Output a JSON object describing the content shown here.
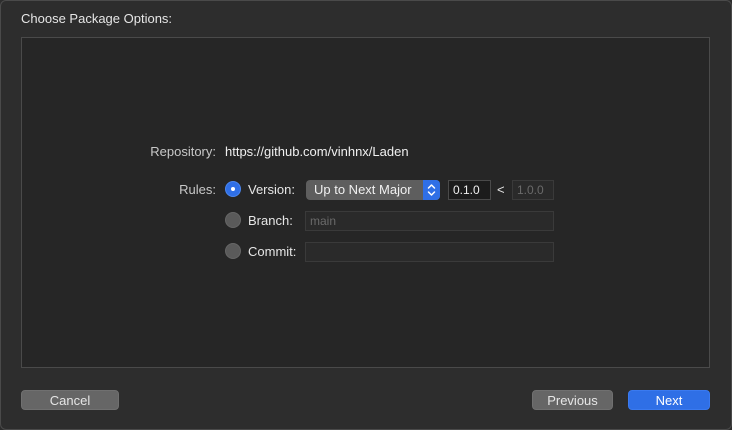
{
  "dialog": {
    "title": "Choose Package Options:"
  },
  "repository": {
    "label": "Repository:",
    "url": "https://github.com/vinhnx/Laden"
  },
  "rules": {
    "label": "Rules:",
    "version": {
      "label": "Version:",
      "selected": true,
      "mode": "Up to Next Major",
      "from": "0.1.0",
      "separator": "<",
      "to": "1.0.0"
    },
    "branch": {
      "label": "Branch:",
      "selected": false,
      "placeholder": "main"
    },
    "commit": {
      "label": "Commit:",
      "selected": false,
      "value": ""
    }
  },
  "buttons": {
    "cancel": "Cancel",
    "previous": "Previous",
    "next": "Next"
  },
  "colors": {
    "accent": "#2f6fe6",
    "background": "#2d2d2d",
    "panel": "#262626"
  }
}
